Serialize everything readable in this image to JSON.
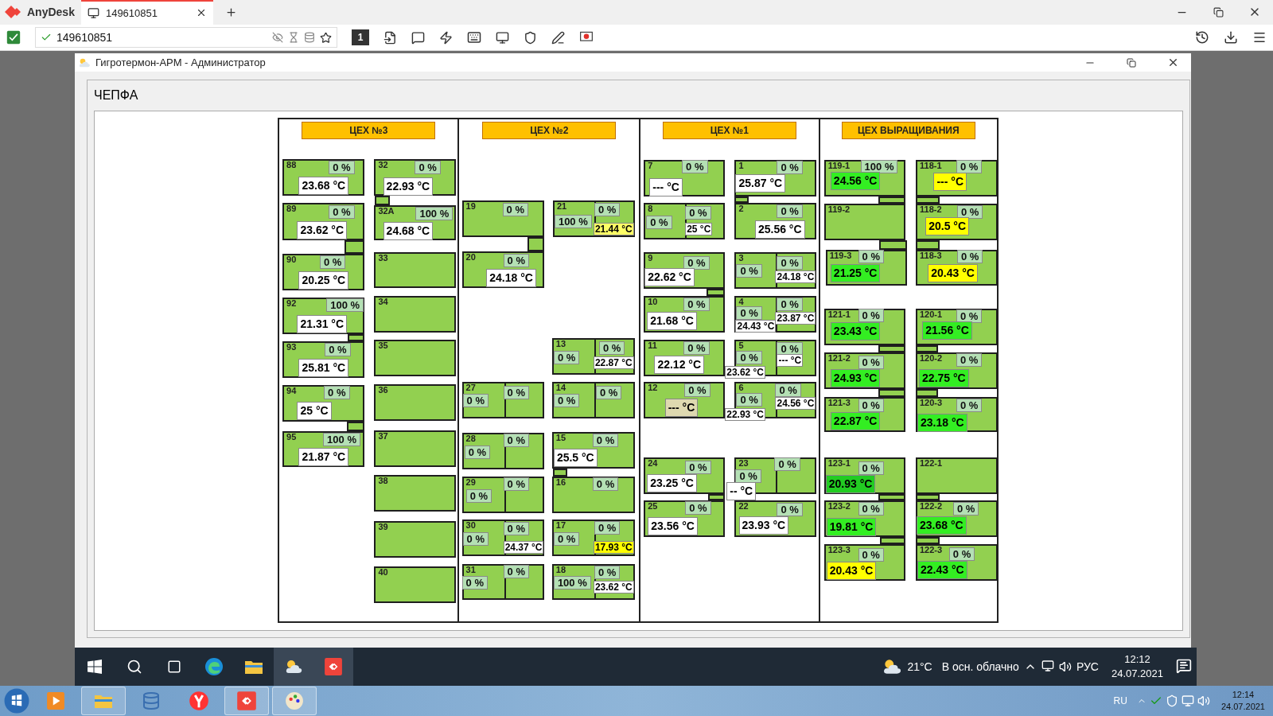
{
  "anydesk": {
    "app_name": "AnyDesk",
    "tab": {
      "label": "149610851",
      "selected": true
    },
    "address": "149610851",
    "display_number": "1"
  },
  "window": {
    "title": "Гигротермон-АРМ - Администратор"
  },
  "panel": {
    "title": "ЧЕПФА"
  },
  "sections": [
    {
      "title": "ЦЕХ №3",
      "rooms": [
        {
          "name": "88",
          "humidity": [
            "0 %"
          ],
          "temps": [
            {
              "value": "23.68 °C",
              "color": "#ffffff"
            }
          ]
        },
        {
          "name": "89",
          "humidity": [
            "0 %"
          ],
          "temps": [
            {
              "value": "23.62 °C",
              "color": "#ffffff"
            }
          ]
        },
        {
          "name": "90",
          "humidity": [
            "0 %"
          ],
          "temps": [
            {
              "value": "20.25 °C",
              "color": "#ffffff"
            }
          ]
        },
        {
          "name": "92",
          "humidity": [
            "100 %"
          ],
          "temps": [
            {
              "value": "21.31 °C",
              "color": "#ffffff"
            }
          ]
        },
        {
          "name": "93",
          "humidity": [
            "0 %"
          ],
          "temps": [
            {
              "value": "25.81 °C",
              "color": "#ffffff"
            }
          ]
        },
        {
          "name": "94",
          "humidity": [
            "0 %"
          ],
          "temps": [
            {
              "value": "25 °C",
              "color": "#ffffff"
            }
          ]
        },
        {
          "name": "95",
          "humidity": [
            "100 %"
          ],
          "temps": [
            {
              "value": "21.87 °C",
              "color": "#ffffff"
            }
          ]
        },
        {
          "name": "32",
          "humidity": [
            "0 %"
          ],
          "temps": [
            {
              "value": "22.93 °C",
              "color": "#ffffff"
            }
          ]
        },
        {
          "name": "32A",
          "humidity": [
            "100 %"
          ],
          "temps": [
            {
              "value": "24.68 °C",
              "color": "#ffffff"
            }
          ]
        },
        {
          "name": "33"
        },
        {
          "name": "34"
        },
        {
          "name": "35"
        },
        {
          "name": "36"
        },
        {
          "name": "37"
        },
        {
          "name": "38"
        },
        {
          "name": "39"
        },
        {
          "name": "40"
        }
      ]
    },
    {
      "title": "ЦЕХ №2",
      "rooms": [
        {
          "name": "19",
          "humidity": [
            "0 %"
          ]
        },
        {
          "name": "21",
          "humidity": [
            "100 %",
            "0 %"
          ],
          "temps": [
            {
              "value": "21.44 °C",
              "color": "#ffff66"
            }
          ]
        },
        {
          "name": "20",
          "humidity": [
            "0 %"
          ],
          "temps": [
            {
              "value": "24.18 °C",
              "color": "#ffffff"
            }
          ]
        },
        {
          "name": "13",
          "humidity": [
            "0 %",
            "0 %"
          ],
          "temps": [
            {
              "value": "22.87 °C",
              "color": "#ffffff"
            }
          ]
        },
        {
          "name": "27",
          "humidity": [
            "0 %",
            "0 %"
          ]
        },
        {
          "name": "14",
          "humidity": [
            "0 %",
            "0 %"
          ]
        },
        {
          "name": "28",
          "humidity": [
            "0 %",
            "0 %"
          ]
        },
        {
          "name": "15",
          "humidity": [
            "0 %"
          ],
          "temps": [
            {
              "value": "25.5 °C",
              "color": "#ffffff"
            }
          ]
        },
        {
          "name": "29",
          "humidity": [
            "0 %",
            "0 %"
          ]
        },
        {
          "name": "16",
          "humidity": [
            "0 %"
          ]
        },
        {
          "name": "30",
          "humidity": [
            "0 %",
            "0 %"
          ],
          "temps": [
            {
              "value": "24.37 °C",
              "color": "#ffffff"
            }
          ]
        },
        {
          "name": "17",
          "humidity": [
            "0 %",
            "0 %"
          ],
          "temps": [
            {
              "value": "17.93 °C",
              "color": "#ffff00"
            }
          ]
        },
        {
          "name": "31",
          "humidity": [
            "0 %",
            "0 %"
          ]
        },
        {
          "name": "18",
          "humidity": [
            "100 %",
            "0 %"
          ],
          "temps": [
            {
              "value": "23.62 °C",
              "color": "#ffffff"
            }
          ]
        }
      ]
    },
    {
      "title": "ЦЕХ №1",
      "rooms": [
        {
          "name": "7",
          "humidity": [
            "0 %"
          ],
          "temps": [
            {
              "value": "--- °C",
              "color": "#ffffff"
            }
          ]
        },
        {
          "name": "1",
          "humidity": [
            "0 %"
          ],
          "temps": [
            {
              "value": "25.87 °C",
              "color": "#ffffff"
            }
          ]
        },
        {
          "name": "8",
          "humidity": [
            "0 %",
            "0 %"
          ],
          "temps": [
            {
              "value": "25 °C",
              "color": "#ffffff"
            }
          ]
        },
        {
          "name": "2",
          "humidity": [
            "0 %"
          ],
          "temps": [
            {
              "value": "25.56 °C",
              "color": "#ffffff"
            }
          ]
        },
        {
          "name": "9",
          "humidity": [
            "0 %"
          ],
          "temps": [
            {
              "value": "22.62 °C",
              "color": "#ffffff"
            }
          ]
        },
        {
          "name": "3",
          "humidity": [
            "0 %",
            "0 %"
          ],
          "temps": [
            {
              "value": "24.18 °C",
              "color": "#ffffff"
            }
          ]
        },
        {
          "name": "10",
          "humidity": [
            "0 %"
          ],
          "temps": [
            {
              "value": "21.68 °C",
              "color": "#ffffff"
            }
          ]
        },
        {
          "name": "4",
          "humidity": [
            "0 %",
            "0 %"
          ],
          "temps": [
            {
              "value": "24.43 °C",
              "color": "#ffffff"
            },
            {
              "value": "23.87 °C",
              "color": "#ffffff"
            }
          ]
        },
        {
          "name": "11",
          "humidity": [
            "0 %"
          ],
          "temps": [
            {
              "value": "22.12 °C",
              "color": "#ffffff"
            }
          ]
        },
        {
          "name": "5",
          "humidity": [
            "0 %",
            "0 %"
          ],
          "temps": [
            {
              "value": "23.62 °C",
              "color": "#ffffff"
            },
            {
              "value": "--- °C",
              "color": "#ffffff"
            }
          ]
        },
        {
          "name": "12",
          "humidity": [
            "0 %"
          ],
          "temps": [
            {
              "value": "--- °C",
              "color": "#ded9b0"
            }
          ]
        },
        {
          "name": "6",
          "humidity": [
            "0 %",
            "0 %"
          ],
          "temps": [
            {
              "value": "22.93 °C",
              "color": "#ffffff"
            },
            {
              "value": "24.56 °C",
              "color": "#ffffff"
            }
          ]
        },
        {
          "name": "24",
          "humidity": [
            "0 %"
          ],
          "temps": [
            {
              "value": "23.25 °C",
              "color": "#ffffff"
            }
          ]
        },
        {
          "name": "23",
          "humidity": [
            "0 %",
            "0 %"
          ],
          "temps": [
            {
              "value": "-- °C",
              "color": "#ffffff"
            }
          ]
        },
        {
          "name": "25",
          "humidity": [
            "0 %"
          ],
          "temps": [
            {
              "value": "23.56 °C",
              "color": "#ffffff"
            }
          ]
        },
        {
          "name": "22",
          "humidity": [
            "0 %"
          ],
          "temps": [
            {
              "value": "23.93 °C",
              "color": "#ffffff"
            }
          ]
        }
      ]
    },
    {
      "title": "ЦЕХ ВЫРАЩИВАНИЯ",
      "rooms": [
        {
          "name": "119-1",
          "humidity": [
            "100 %"
          ],
          "temps": [
            {
              "value": "24.56 °C",
              "color": "#33ee22"
            }
          ]
        },
        {
          "name": "118-1",
          "humidity": [
            "0 %"
          ],
          "temps": [
            {
              "value": "--- °C",
              "color": "#ffff00"
            }
          ]
        },
        {
          "name": "119-2"
        },
        {
          "name": "118-2",
          "humidity": [
            "0 %"
          ],
          "temps": [
            {
              "value": "20.5 °C",
              "color": "#ffff00"
            }
          ]
        },
        {
          "name": "119-3",
          "humidity": [
            "0 %"
          ],
          "temps": [
            {
              "value": "21.25 °C",
              "color": "#33ee22"
            }
          ]
        },
        {
          "name": "118-3",
          "humidity": [
            "0 %"
          ],
          "temps": [
            {
              "value": "20.43 °C",
              "color": "#ffff00"
            }
          ]
        },
        {
          "name": "121-1",
          "humidity": [
            "0 %"
          ],
          "temps": [
            {
              "value": "23.43 °C",
              "color": "#33ee22"
            }
          ]
        },
        {
          "name": "120-1",
          "humidity": [
            "0 %"
          ],
          "temps": [
            {
              "value": "21.56 °C",
              "color": "#33ee22"
            }
          ]
        },
        {
          "name": "121-2",
          "humidity": [
            "0 %"
          ],
          "temps": [
            {
              "value": "24.93 °C",
              "color": "#33ee22"
            }
          ]
        },
        {
          "name": "120-2",
          "humidity": [
            "0 %"
          ],
          "temps": [
            {
              "value": "22.75 °C",
              "color": "#33ee22"
            }
          ]
        },
        {
          "name": "121-3",
          "humidity": [
            "0 %"
          ],
          "temps": [
            {
              "value": "22.87 °C",
              "color": "#33ee22"
            }
          ]
        },
        {
          "name": "120-3",
          "humidity": [
            "0 %"
          ],
          "temps": [
            {
              "value": "23.18 °C",
              "color": "#33ee22"
            }
          ]
        },
        {
          "name": "123-1",
          "humidity": [
            "0 %"
          ],
          "temps": [
            {
              "value": "20.93 °C",
              "color": "#22cc22"
            }
          ]
        },
        {
          "name": "122-1"
        },
        {
          "name": "123-2",
          "humidity": [
            "0 %"
          ],
          "temps": [
            {
              "value": "19.81 °C",
              "color": "#33ee22"
            }
          ]
        },
        {
          "name": "122-2",
          "humidity": [
            "0 %"
          ],
          "temps": [
            {
              "value": "23.68 °C",
              "color": "#33ee22"
            }
          ]
        },
        {
          "name": "123-3",
          "humidity": [
            "0 %"
          ],
          "temps": [
            {
              "value": "20.43 °C",
              "color": "#ffff00"
            }
          ]
        },
        {
          "name": "122-3",
          "humidity": [
            "0 %"
          ],
          "temps": [
            {
              "value": "22.43 °C",
              "color": "#33ee22"
            }
          ]
        }
      ]
    }
  ],
  "remote_taskbar": {
    "weather_temperature": "21°C",
    "weather_condition": "В осн. облачно",
    "language": "РУС",
    "time": "12:12",
    "date": "24.07.2021"
  },
  "host_taskbar": {
    "language": "RU",
    "time": "12:14",
    "date": "24.07.2021"
  }
}
